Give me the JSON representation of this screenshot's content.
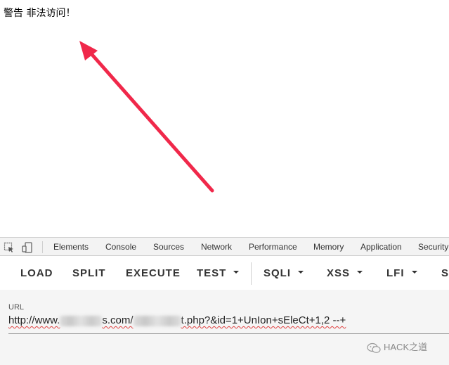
{
  "page": {
    "warning_text": "警告 非法访问！"
  },
  "devtools": {
    "tabs": [
      "Elements",
      "Console",
      "Sources",
      "Network",
      "Performance",
      "Memory",
      "Application",
      "Security"
    ]
  },
  "hackbar": {
    "load": "LOAD",
    "split": "SPLIT",
    "execute": "EXECUTE",
    "test": "TEST",
    "sqli": "SQLI",
    "xss": "XSS",
    "lfi": "LFI",
    "more": "S"
  },
  "url_panel": {
    "label": "URL",
    "part1": "http://www.",
    "part2": "s.com/",
    "part3": "t.php?&id=1+UnIon+sEleCt+1,2 --+"
  },
  "watermark": {
    "text": "HACK之道"
  },
  "colors": {
    "arrow": "#f0284a",
    "devtools_bg": "#f3f3f3",
    "url_panel_bg": "#f5f5f5"
  }
}
